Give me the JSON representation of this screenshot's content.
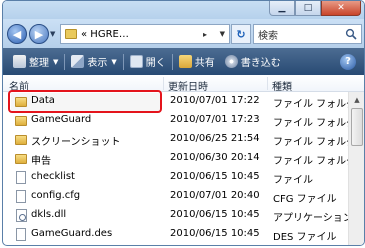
{
  "address": {
    "path": "« HGRE…"
  },
  "search": {
    "placeholder": "検索"
  },
  "toolbar": {
    "organize": "整理",
    "view": "表示",
    "open": "開く",
    "share": "共有",
    "burn": "書き込む"
  },
  "columns": {
    "name": "名前",
    "date": "更新日時",
    "type": "種類"
  },
  "files": [
    {
      "name": "Data",
      "date": "2010/07/01 17:22",
      "type": "ファイル フォルダ",
      "icon": "folder"
    },
    {
      "name": "GameGuard",
      "date": "2010/07/01 17:23",
      "type": "ファイル フォルダ",
      "icon": "folder"
    },
    {
      "name": "スクリーンショット",
      "date": "2010/06/25 21:54",
      "type": "ファイル フォルダ",
      "icon": "folder"
    },
    {
      "name": "申告",
      "date": "2010/06/30 20:14",
      "type": "ファイル フォルダ",
      "icon": "folder"
    },
    {
      "name": "checklist",
      "date": "2010/06/15 10:45",
      "type": "ファイル",
      "icon": "file"
    },
    {
      "name": "config.cfg",
      "date": "2010/07/01 20:40",
      "type": "CFG ファイル",
      "icon": "file"
    },
    {
      "name": "dkls.dll",
      "date": "2010/06/15 10:45",
      "type": "アプリケーション拡",
      "icon": "gear"
    },
    {
      "name": "GameGuard.des",
      "date": "2010/06/15 10:45",
      "type": "DES ファイル",
      "icon": "file"
    }
  ],
  "colors": {
    "highlight": "#e4141c",
    "toolbar": "#2f5077"
  }
}
